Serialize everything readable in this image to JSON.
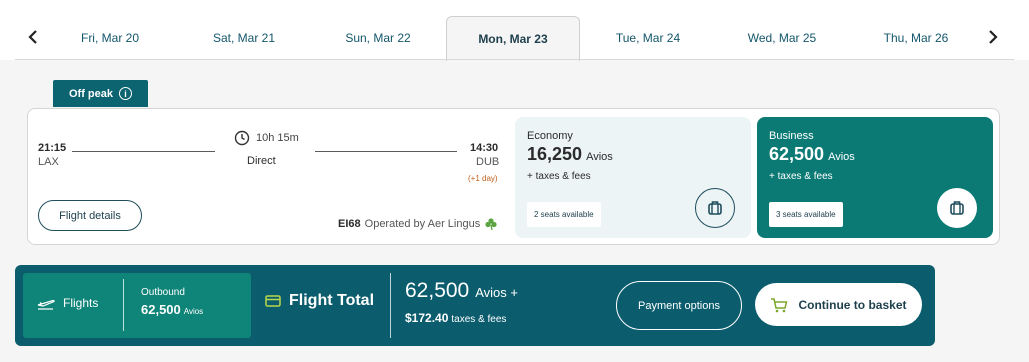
{
  "dates": {
    "tabs": [
      {
        "label": "Fri, Mar 20"
      },
      {
        "label": "Sat, Mar 21"
      },
      {
        "label": "Sun, Mar 22"
      },
      {
        "label": "Mon, Mar 23",
        "active": true
      },
      {
        "label": "Tue, Mar 24"
      },
      {
        "label": "Wed, Mar 25"
      },
      {
        "label": "Thu, Mar 26"
      }
    ]
  },
  "tag": {
    "label": "Off peak",
    "icon": "info-icon"
  },
  "flight": {
    "depart_time": "21:15",
    "depart_airport": "LAX",
    "duration": "10h 15m",
    "stops": "Direct",
    "arrive_time": "14:30",
    "arrive_airport": "DUB",
    "next_day": "(+1 day)",
    "details_label": "Flight details",
    "flight_number": "EI68",
    "operated_by": "Operated by Aer Lingus",
    "economy": {
      "cabin": "Economy",
      "amount": "16,250",
      "unit": "Avios",
      "taxes": "+ taxes & fees",
      "seats": "2 seats available"
    },
    "business": {
      "cabin": "Business",
      "amount": "62,500",
      "unit": "Avios",
      "taxes": "+ taxes & fees",
      "seats": "3 seats available"
    }
  },
  "summary": {
    "flights_label": "Flights",
    "outbound_label": "Outbound",
    "outbound_amount": "62,500",
    "outbound_unit": "Avios",
    "total_label": "Flight Total",
    "total_avios": "62,500",
    "total_avios_suffix": "Avios +",
    "total_cash": "$172.40",
    "total_cash_suffix": "taxes & fees",
    "payment_options": "Payment options",
    "continue": "Continue to basket"
  },
  "colors": {
    "brand_teal": "#0b5d6e",
    "business_green": "#0c7a74",
    "economy_bg": "#edf4f6"
  }
}
